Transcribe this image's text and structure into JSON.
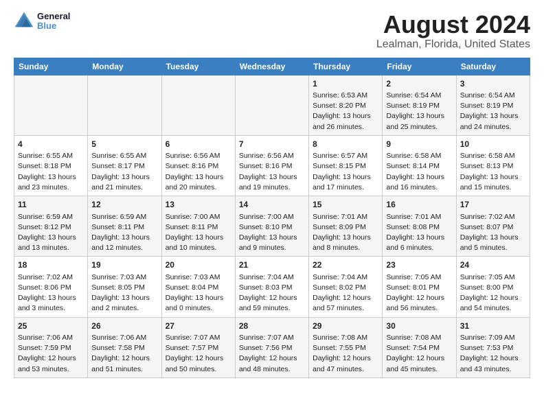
{
  "header": {
    "logo_line1": "General",
    "logo_line2": "Blue",
    "title": "August 2024",
    "subtitle": "Lealman, Florida, United States"
  },
  "calendar": {
    "days_of_week": [
      "Sunday",
      "Monday",
      "Tuesday",
      "Wednesday",
      "Thursday",
      "Friday",
      "Saturday"
    ],
    "weeks": [
      [
        {
          "day": "",
          "content": ""
        },
        {
          "day": "",
          "content": ""
        },
        {
          "day": "",
          "content": ""
        },
        {
          "day": "",
          "content": ""
        },
        {
          "day": "1",
          "content": "Sunrise: 6:53 AM\nSunset: 8:20 PM\nDaylight: 13 hours\nand 26 minutes."
        },
        {
          "day": "2",
          "content": "Sunrise: 6:54 AM\nSunset: 8:19 PM\nDaylight: 13 hours\nand 25 minutes."
        },
        {
          "day": "3",
          "content": "Sunrise: 6:54 AM\nSunset: 8:19 PM\nDaylight: 13 hours\nand 24 minutes."
        }
      ],
      [
        {
          "day": "4",
          "content": "Sunrise: 6:55 AM\nSunset: 8:18 PM\nDaylight: 13 hours\nand 23 minutes."
        },
        {
          "day": "5",
          "content": "Sunrise: 6:55 AM\nSunset: 8:17 PM\nDaylight: 13 hours\nand 21 minutes."
        },
        {
          "day": "6",
          "content": "Sunrise: 6:56 AM\nSunset: 8:16 PM\nDaylight: 13 hours\nand 20 minutes."
        },
        {
          "day": "7",
          "content": "Sunrise: 6:56 AM\nSunset: 8:16 PM\nDaylight: 13 hours\nand 19 minutes."
        },
        {
          "day": "8",
          "content": "Sunrise: 6:57 AM\nSunset: 8:15 PM\nDaylight: 13 hours\nand 17 minutes."
        },
        {
          "day": "9",
          "content": "Sunrise: 6:58 AM\nSunset: 8:14 PM\nDaylight: 13 hours\nand 16 minutes."
        },
        {
          "day": "10",
          "content": "Sunrise: 6:58 AM\nSunset: 8:13 PM\nDaylight: 13 hours\nand 15 minutes."
        }
      ],
      [
        {
          "day": "11",
          "content": "Sunrise: 6:59 AM\nSunset: 8:12 PM\nDaylight: 13 hours\nand 13 minutes."
        },
        {
          "day": "12",
          "content": "Sunrise: 6:59 AM\nSunset: 8:11 PM\nDaylight: 13 hours\nand 12 minutes."
        },
        {
          "day": "13",
          "content": "Sunrise: 7:00 AM\nSunset: 8:11 PM\nDaylight: 13 hours\nand 10 minutes."
        },
        {
          "day": "14",
          "content": "Sunrise: 7:00 AM\nSunset: 8:10 PM\nDaylight: 13 hours\nand 9 minutes."
        },
        {
          "day": "15",
          "content": "Sunrise: 7:01 AM\nSunset: 8:09 PM\nDaylight: 13 hours\nand 8 minutes."
        },
        {
          "day": "16",
          "content": "Sunrise: 7:01 AM\nSunset: 8:08 PM\nDaylight: 13 hours\nand 6 minutes."
        },
        {
          "day": "17",
          "content": "Sunrise: 7:02 AM\nSunset: 8:07 PM\nDaylight: 13 hours\nand 5 minutes."
        }
      ],
      [
        {
          "day": "18",
          "content": "Sunrise: 7:02 AM\nSunset: 8:06 PM\nDaylight: 13 hours\nand 3 minutes."
        },
        {
          "day": "19",
          "content": "Sunrise: 7:03 AM\nSunset: 8:05 PM\nDaylight: 13 hours\nand 2 minutes."
        },
        {
          "day": "20",
          "content": "Sunrise: 7:03 AM\nSunset: 8:04 PM\nDaylight: 13 hours\nand 0 minutes."
        },
        {
          "day": "21",
          "content": "Sunrise: 7:04 AM\nSunset: 8:03 PM\nDaylight: 12 hours\nand 59 minutes."
        },
        {
          "day": "22",
          "content": "Sunrise: 7:04 AM\nSunset: 8:02 PM\nDaylight: 12 hours\nand 57 minutes."
        },
        {
          "day": "23",
          "content": "Sunrise: 7:05 AM\nSunset: 8:01 PM\nDaylight: 12 hours\nand 56 minutes."
        },
        {
          "day": "24",
          "content": "Sunrise: 7:05 AM\nSunset: 8:00 PM\nDaylight: 12 hours\nand 54 minutes."
        }
      ],
      [
        {
          "day": "25",
          "content": "Sunrise: 7:06 AM\nSunset: 7:59 PM\nDaylight: 12 hours\nand 53 minutes."
        },
        {
          "day": "26",
          "content": "Sunrise: 7:06 AM\nSunset: 7:58 PM\nDaylight: 12 hours\nand 51 minutes."
        },
        {
          "day": "27",
          "content": "Sunrise: 7:07 AM\nSunset: 7:57 PM\nDaylight: 12 hours\nand 50 minutes."
        },
        {
          "day": "28",
          "content": "Sunrise: 7:07 AM\nSunset: 7:56 PM\nDaylight: 12 hours\nand 48 minutes."
        },
        {
          "day": "29",
          "content": "Sunrise: 7:08 AM\nSunset: 7:55 PM\nDaylight: 12 hours\nand 47 minutes."
        },
        {
          "day": "30",
          "content": "Sunrise: 7:08 AM\nSunset: 7:54 PM\nDaylight: 12 hours\nand 45 minutes."
        },
        {
          "day": "31",
          "content": "Sunrise: 7:09 AM\nSunset: 7:53 PM\nDaylight: 12 hours\nand 43 minutes."
        }
      ]
    ]
  }
}
